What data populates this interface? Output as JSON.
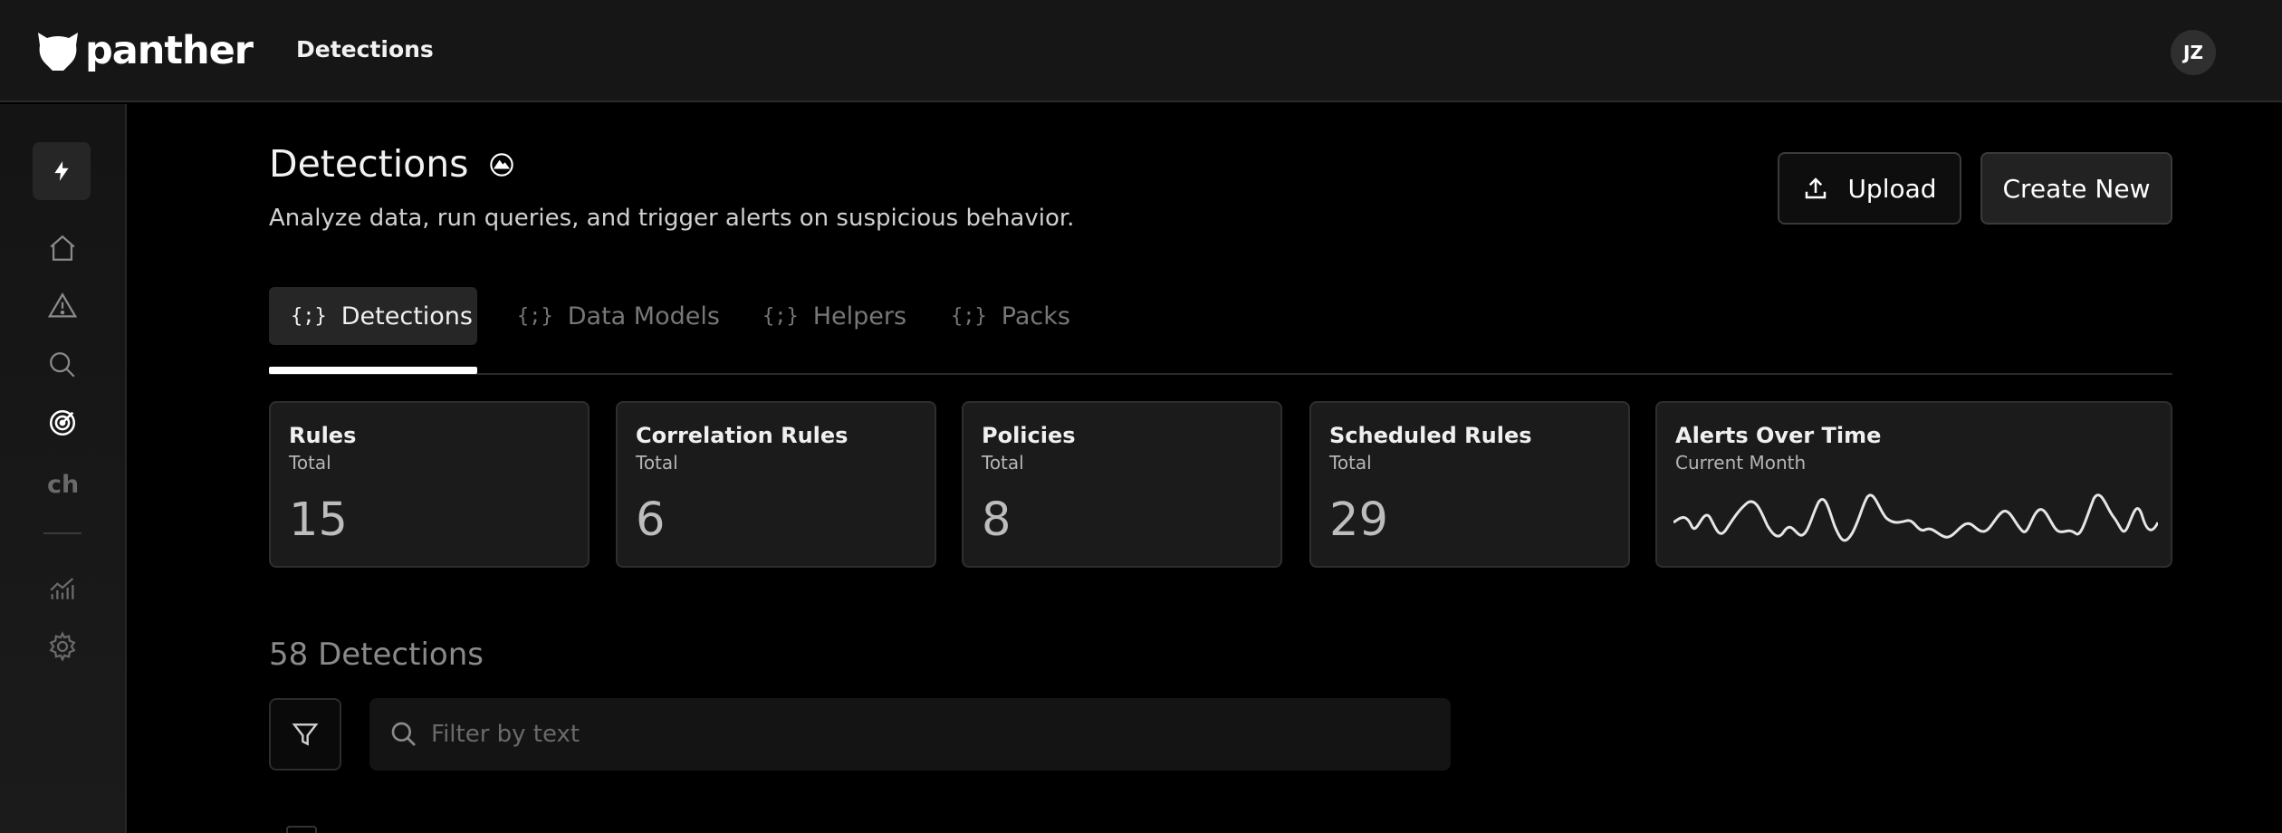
{
  "header": {
    "logo_text": "panther",
    "title": "Detections",
    "avatar_initials": "JZ"
  },
  "sidebar": {
    "items": [
      {
        "icon": "bolt-icon",
        "active": true
      },
      {
        "icon": "home-icon"
      },
      {
        "icon": "alert-triangle-icon"
      },
      {
        "icon": "search-icon"
      },
      {
        "icon": "detections-target-icon"
      },
      {
        "label": "ch"
      },
      {
        "icon": "chart-icon"
      },
      {
        "icon": "gear-icon"
      }
    ]
  },
  "page": {
    "title": "Detections",
    "subtitle": "Analyze data, run queries, and trigger alerts on suspicious behavior.",
    "upload_label": "Upload",
    "create_label": "Create New"
  },
  "tabs": [
    {
      "label": "Detections",
      "active": true
    },
    {
      "label": "Data Models"
    },
    {
      "label": "Helpers"
    },
    {
      "label": "Packs"
    }
  ],
  "tab_icon": "{;}",
  "stats": [
    {
      "title": "Rules",
      "sub": "Total",
      "value": "15"
    },
    {
      "title": "Correlation Rules",
      "sub": "Total",
      "value": "6"
    },
    {
      "title": "Policies",
      "sub": "Total",
      "value": "8"
    },
    {
      "title": "Scheduled Rules",
      "sub": "Total",
      "value": "29"
    }
  ],
  "alerts_card": {
    "title": "Alerts Over Time",
    "sub": "Current Month"
  },
  "list": {
    "count_label": "58 Detections",
    "search_placeholder": "Filter by text"
  },
  "colors": {
    "background": "#000000",
    "topbar": "#161616",
    "card": "#1b1b1b",
    "accent": "#ffffff"
  }
}
